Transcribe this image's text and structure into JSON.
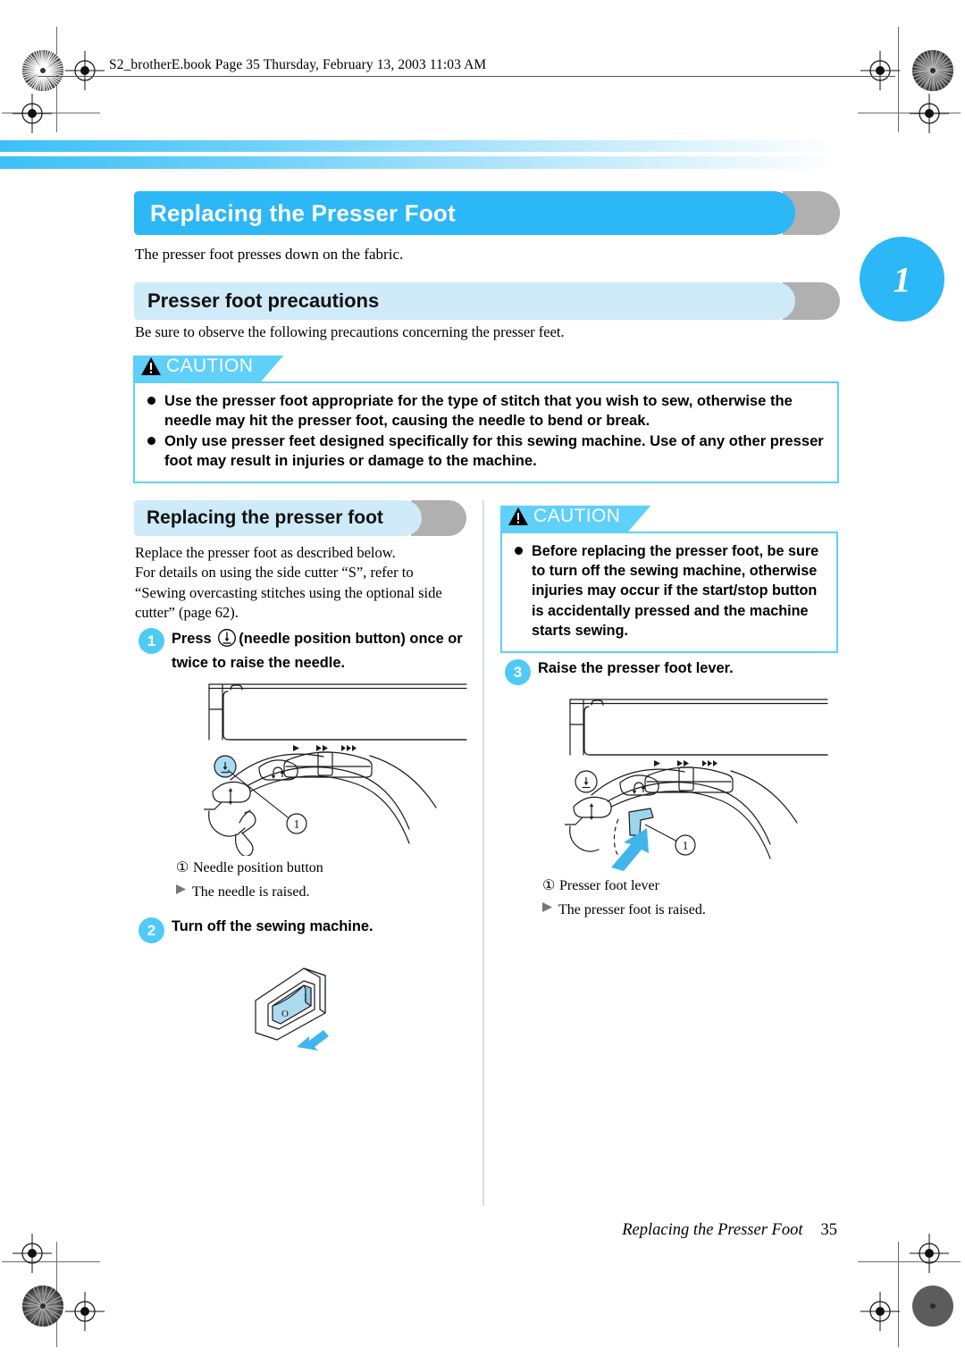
{
  "header": {
    "print_info": "S2_brotherE.book  Page 35  Thursday, February 13, 2003  11:03 AM"
  },
  "chapter_tab": {
    "number": "1"
  },
  "colors": {
    "primary_blue": "#2cb7f6",
    "light_blue": "#cfeaf9",
    "caution_blue": "#5ed0fa",
    "badge_blue": "#4ecbf7",
    "grey_echo": "#b0b0b0",
    "illustration_fill": "#b8dff2"
  },
  "main": {
    "title": "Replacing the Presser Foot",
    "intro": "The presser foot presses down on the fabric.",
    "section_precautions": {
      "heading": "Presser foot precautions",
      "intro": "Be sure to observe the following precautions concerning the presser feet.",
      "caution": {
        "label": "CAUTION",
        "items": [
          "Use the presser foot appropriate for the type of stitch that you wish to sew, otherwise the needle may hit the presser foot, causing the needle to bend or break.",
          "Only use presser feet designed specifically for this sewing machine. Use of any other presser foot may result in injuries or damage to the machine."
        ]
      }
    },
    "section_replacing": {
      "heading": "Replacing the presser foot",
      "body_lines": [
        "Replace the presser foot as described below.",
        "For details on using the side cutter “S”, refer to",
        "“Sewing overcasting stitches using the optional side",
        "cutter” (page 62)."
      ],
      "steps": [
        {
          "number": "1",
          "text_before_icon": "Press",
          "icon_name": "needle-position-button-icon",
          "text_after_icon": "(needle position button) once or",
          "text_line2": "twice to raise the needle.",
          "figure_caption_num": "①",
          "figure_caption": "Needle position button",
          "result": "The needle is raised."
        },
        {
          "number": "2",
          "text": "Turn off the sewing machine."
        },
        {
          "number": "3",
          "text": "Raise the presser foot lever.",
          "figure_caption_num": "①",
          "figure_caption": "Presser foot lever",
          "result": "The presser foot is raised."
        }
      ],
      "caution": {
        "label": "CAUTION",
        "items": [
          "Before replacing the presser foot, be sure to turn off the sewing machine, otherwise injuries may occur if the start/stop button is accidentally pressed and the machine starts sewing."
        ]
      }
    }
  },
  "footer": {
    "running_title": "Replacing the Presser Foot",
    "page_number": "35"
  }
}
